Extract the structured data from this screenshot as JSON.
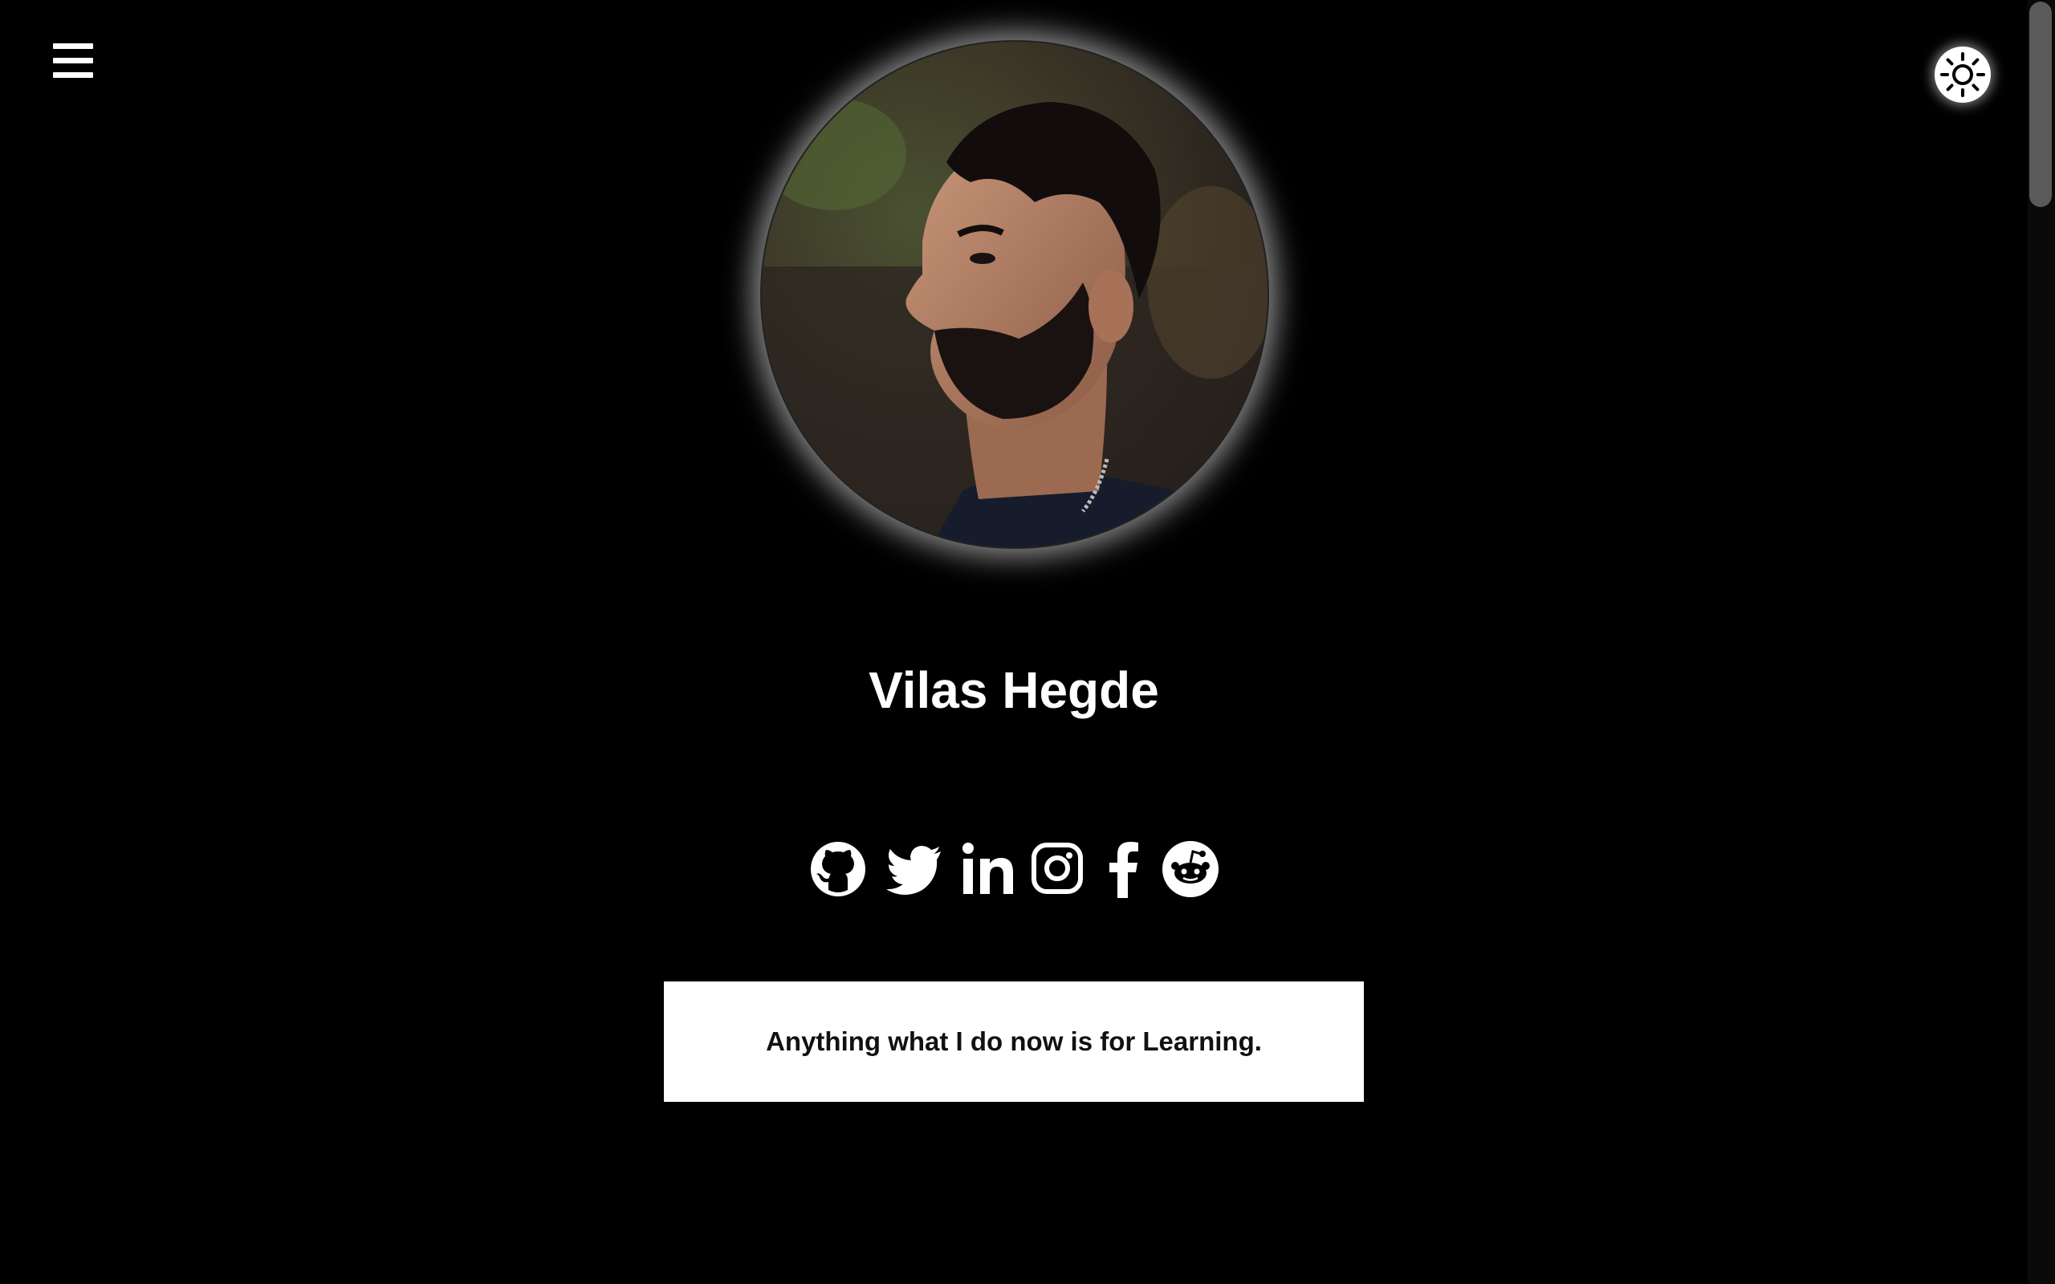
{
  "header": {
    "menu_icon": "hamburger-menu-icon",
    "theme_icon": "sun-icon"
  },
  "profile": {
    "name": "Vilas Hegde",
    "photo_alt": "Profile photo"
  },
  "socials": [
    {
      "name": "github",
      "icon": "github-icon"
    },
    {
      "name": "twitter",
      "icon": "twitter-icon"
    },
    {
      "name": "linkedin",
      "icon": "linkedin-icon"
    },
    {
      "name": "instagram",
      "icon": "instagram-icon"
    },
    {
      "name": "facebook",
      "icon": "facebook-icon"
    },
    {
      "name": "reddit",
      "icon": "reddit-icon"
    }
  ],
  "quote": {
    "text": "Anything what I do now is for Learning."
  },
  "colors": {
    "background": "#000000",
    "foreground": "#ffffff",
    "quote_text": "#111111"
  }
}
